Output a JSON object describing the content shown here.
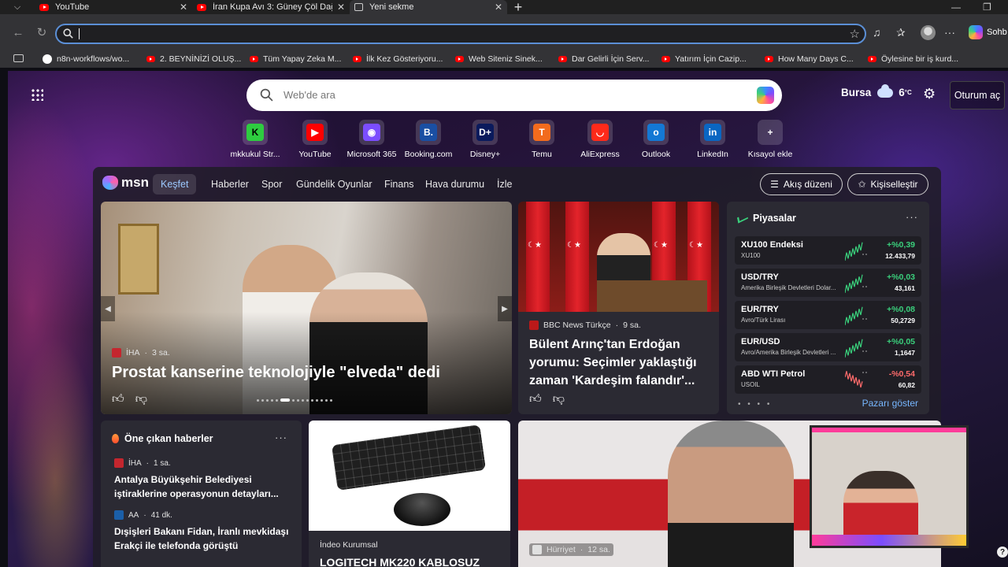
{
  "tabs": [
    {
      "title": "YouTube",
      "favicon": "youtube-icon",
      "active": false
    },
    {
      "title": "İran Kupa Avı 3: Güney Çöl Dağ Ke",
      "favicon": "youtube-icon",
      "active": false
    },
    {
      "title": "Yeni sekme",
      "favicon": "page-icon",
      "active": true
    }
  ],
  "toolbar": {
    "address_value": "",
    "profile_label": "Sohb"
  },
  "bookmarks": [
    {
      "label": "n8n-workflows/wo...",
      "icon": "github-icon"
    },
    {
      "label": "2. BEYNİNİZİ OLUŞ...",
      "icon": "youtube-icon"
    },
    {
      "label": "Tüm Yapay Zeka M...",
      "icon": "youtube-icon"
    },
    {
      "label": "İlk Kez Gösteriyoru...",
      "icon": "youtube-icon"
    },
    {
      "label": "Web Siteniz Sinek...",
      "icon": "youtube-icon"
    },
    {
      "label": "Dar Gelirli İçin Serv...",
      "icon": "youtube-icon"
    },
    {
      "label": "Yatırım İçin Cazip...",
      "icon": "youtube-icon"
    },
    {
      "label": "How Many Days C...",
      "icon": "youtube-icon"
    },
    {
      "label": "Öylesine bir iş kurd...",
      "icon": "youtube-icon"
    }
  ],
  "newtab": {
    "search_placeholder": "Web'de ara",
    "weather": {
      "city": "Bursa",
      "temp": "6",
      "unit": "°C",
      "icon": "cloud-icon"
    },
    "signin_label": "Oturum aç"
  },
  "quick_links": [
    {
      "label": "mkkukul Str...",
      "glyph": "K",
      "color": "#2ecc40",
      "fg": "#000000"
    },
    {
      "label": "YouTube",
      "glyph": "▶",
      "color": "#ff0000",
      "fg": "#ffffff"
    },
    {
      "label": "Microsoft 365",
      "glyph": "◉",
      "color": "#7b4dff",
      "fg": "#ffffff"
    },
    {
      "label": "Booking.com",
      "glyph": "B.",
      "color": "#1a4fa3",
      "fg": "#ffffff"
    },
    {
      "label": "Disney+",
      "glyph": "D+",
      "color": "#0a1a5c",
      "fg": "#ffffff"
    },
    {
      "label": "Temu",
      "glyph": "T",
      "color": "#f26b1d",
      "fg": "#ffffff"
    },
    {
      "label": "AliExpress",
      "glyph": "◡",
      "color": "#ff2a1a",
      "fg": "#ffffff"
    },
    {
      "label": "Outlook",
      "glyph": "o",
      "color": "#1478d4",
      "fg": "#ffffff"
    },
    {
      "label": "LinkedIn",
      "glyph": "in",
      "color": "#0a66c2",
      "fg": "#ffffff"
    },
    {
      "label": "Kısayol ekle",
      "glyph": "+",
      "color": "transparent",
      "fg": "#ffffff"
    }
  ],
  "feed_nav": {
    "brand": "msn",
    "items": [
      "Keşfet",
      "Haberler",
      "Spor",
      "Gündelik Oyunlar",
      "Finans",
      "Hava durumu",
      "İzle"
    ],
    "layout_button": "Akış düzeni",
    "personalize_button": "Kişiselleştir"
  },
  "hero": {
    "source": "İHA",
    "time": "3 sa.",
    "headline": "Prostat kanserine teknolojiyle \"elveda\" dedi"
  },
  "card2": {
    "source": "BBC News Türkçe",
    "time": "9 sa.",
    "headline": "Bülent Arınç'tan Erdoğan yorumu: Seçimler yaklaştığı zaman 'Kardeşim falandır'..."
  },
  "markets": {
    "title": "Piyasalar",
    "more_label": "Pazarı göster",
    "rows": [
      {
        "symbol": "XU100 Endeksi",
        "desc": "XU100",
        "change": "+%0,39",
        "price": "12.433,79",
        "up": true
      },
      {
        "symbol": "USD/TRY",
        "desc": "Amerika Birleşik Devletleri Dolar...",
        "change": "+%0,03",
        "price": "43,161",
        "up": true
      },
      {
        "symbol": "EUR/TRY",
        "desc": "Avro/Türk Lirası",
        "change": "+%0,08",
        "price": "50,2729",
        "up": true
      },
      {
        "symbol": "EUR/USD",
        "desc": "Avro/Amerika Birleşik Devletleri ...",
        "change": "+%0,05",
        "price": "1,1647",
        "up": true
      },
      {
        "symbol": "ABD WTI Petrol",
        "desc": "USOIL",
        "change": "-%0,54",
        "price": "60,82",
        "up": false
      }
    ]
  },
  "trending": {
    "title": "Öne çıkan haberler",
    "items": [
      {
        "source": "İHA",
        "time": "1 sa.",
        "text": "Antalya Büyükşehir Belediyesi iştiraklerine operasyonun detayları..."
      },
      {
        "source": "AA",
        "time": "41 dk.",
        "text": "Dışişleri Bakanı Fidan, İranlı mevkidaşı Erakçi ile telefonda görüştü"
      }
    ]
  },
  "card_kb": {
    "source": "İndeo Kurumsal",
    "headline": "LOGITECH MK220 KABLOSUZ"
  },
  "card_big": {
    "source": "Hürriyet",
    "time": "12 sa."
  },
  "colors": {
    "accent": "#5b8fd6",
    "market_up": "#3ad07c",
    "market_down": "#ff6b6b",
    "link": "#77b7ff"
  }
}
